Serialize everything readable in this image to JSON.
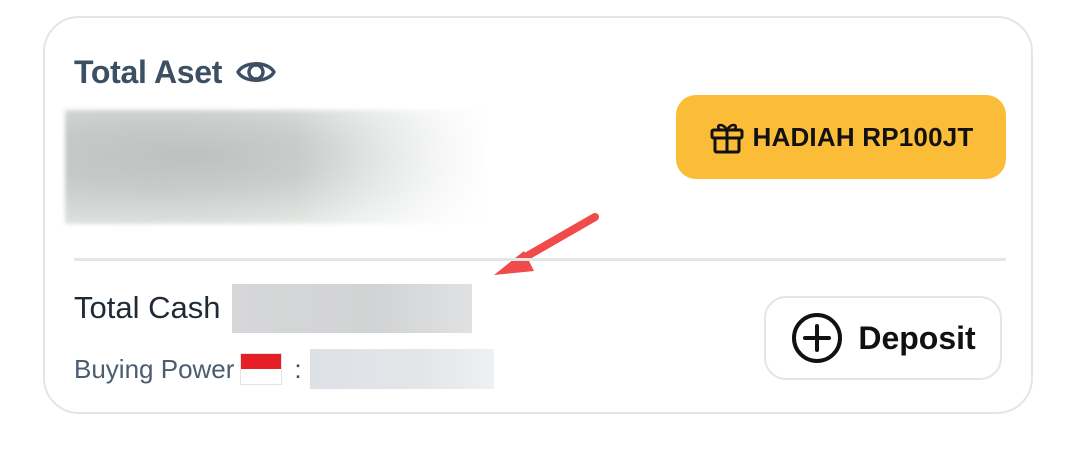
{
  "total_assets": {
    "title": "Total Aset",
    "visibility_icon": "eye-icon",
    "value_obscured": true
  },
  "reward_button": {
    "label": "HADIAH RP100JT",
    "icon": "gift-icon",
    "color": "#fbbd37"
  },
  "cash": {
    "label": "Total Cash",
    "value_obscured": true
  },
  "buying_power": {
    "label": "Buying Power",
    "flag_icon": "indonesia-flag-icon",
    "separator": ":",
    "value_obscured": true
  },
  "deposit_button": {
    "label": "Deposit",
    "icon": "plus-circle-icon"
  },
  "annotation": {
    "arrow_color": "#f04a4a"
  },
  "colors": {
    "title_text": "#3d4f63",
    "border": "#e1e6e6",
    "accent": "#fbbd37"
  }
}
